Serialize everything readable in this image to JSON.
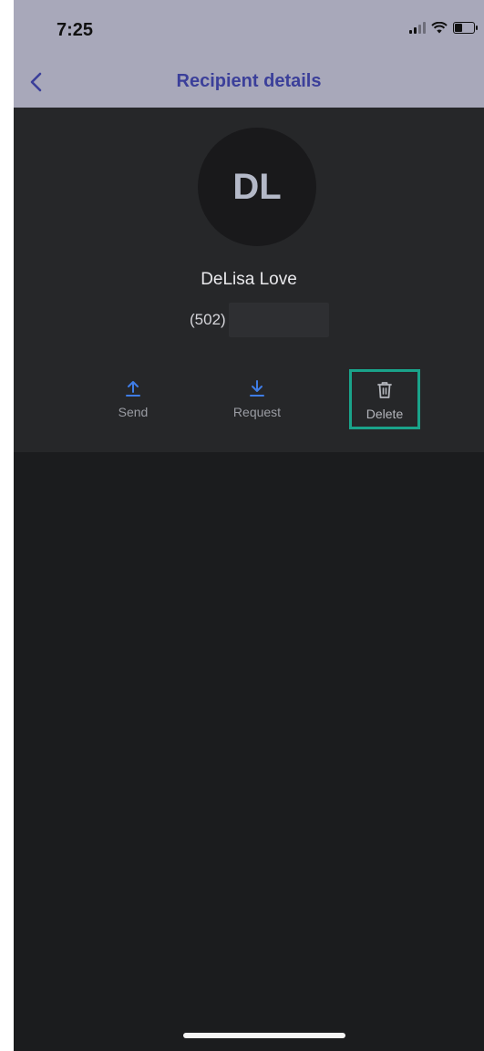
{
  "status_bar": {
    "time": "7:25",
    "icons": [
      "signal-icon",
      "wifi-icon",
      "battery-icon"
    ]
  },
  "nav": {
    "back_icon": "chevron-left-icon",
    "title": "Recipient details"
  },
  "recipient": {
    "initials": "DL",
    "name": "DeLisa Love",
    "phone_prefix": "(502)"
  },
  "actions": [
    {
      "label": "Send",
      "icon": "upload-arrow-icon",
      "color": "#3f7de6"
    },
    {
      "label": "Request",
      "icon": "download-arrow-icon",
      "color": "#3f7de6"
    },
    {
      "label": "Delete",
      "icon": "trash-icon",
      "color": "#b4b6bc",
      "highlighted": true
    }
  ],
  "colors": {
    "nav_bg": "#a8a8ba",
    "title": "#3b3f9a",
    "highlight_border": "#1aa38a",
    "background": "#1b1c1e"
  }
}
